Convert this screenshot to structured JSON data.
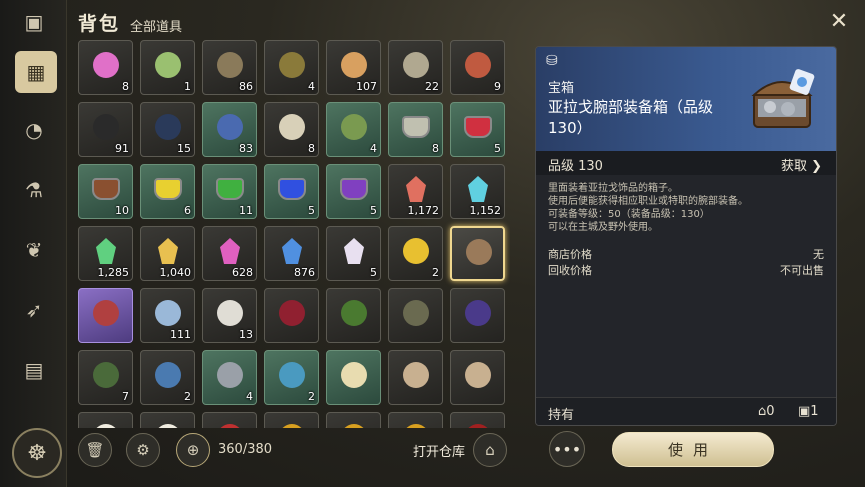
{
  "header": {
    "title": "背包",
    "filter": "全部道具"
  },
  "grid": {
    "rows": [
      [
        {
          "icon": "potion-pink",
          "qty": "8",
          "style": "dark"
        },
        {
          "icon": "potion-green-bottle",
          "qty": "1",
          "style": "dark"
        },
        {
          "icon": "worm",
          "qty": "86",
          "style": "dark"
        },
        {
          "icon": "beetle",
          "qty": "4",
          "style": "dark"
        },
        {
          "icon": "orange-orb",
          "qty": "107",
          "style": "dark"
        },
        {
          "icon": "stone-ball",
          "qty": "22",
          "style": "dark"
        },
        {
          "icon": "red-worm",
          "qty": "9",
          "style": "dark"
        }
      ],
      [
        {
          "icon": "coil-rope",
          "qty": "91",
          "style": "dark"
        },
        {
          "icon": "ink-quill",
          "qty": "15",
          "style": "dark"
        },
        {
          "icon": "blue-book",
          "qty": "83",
          "style": "green"
        },
        {
          "icon": "scroll",
          "qty": "8",
          "style": "dark"
        },
        {
          "icon": "green-scroll",
          "qty": "4",
          "style": "green"
        },
        {
          "icon": "gray-paint",
          "qty": "8",
          "style": "green"
        },
        {
          "icon": "red-paint",
          "qty": "5",
          "style": "green"
        }
      ],
      [
        {
          "icon": "brown-paint",
          "qty": "10",
          "style": "green"
        },
        {
          "icon": "yellow-paint",
          "qty": "6",
          "style": "green"
        },
        {
          "icon": "green-paint",
          "qty": "11",
          "style": "green"
        },
        {
          "icon": "blue-paint",
          "qty": "5",
          "style": "green"
        },
        {
          "icon": "purple-paint",
          "qty": "5",
          "style": "green"
        },
        {
          "icon": "red-crystal",
          "qty": "1,172",
          "style": "dark"
        },
        {
          "icon": "cyan-crystal",
          "qty": "1,152",
          "style": "dark"
        }
      ],
      [
        {
          "icon": "green-crystal",
          "qty": "1,285",
          "style": "dark"
        },
        {
          "icon": "gold-crystal",
          "qty": "1,040",
          "style": "dark"
        },
        {
          "icon": "pink-crystal",
          "qty": "628",
          "style": "dark"
        },
        {
          "icon": "blue-crystal",
          "qty": "876",
          "style": "dark"
        },
        {
          "icon": "prism",
          "qty": "5",
          "style": "dark"
        },
        {
          "icon": "gold-potion",
          "qty": "2",
          "style": "dark"
        },
        {
          "icon": "treasure-chest",
          "qty": "",
          "style": "selected"
        }
      ],
      [
        {
          "icon": "armor",
          "qty": "",
          "style": "purple"
        },
        {
          "icon": "blue-cloth",
          "qty": "111",
          "style": "dark"
        },
        {
          "icon": "white-cube",
          "qty": "13",
          "style": "dark"
        },
        {
          "icon": "red-dye",
          "qty": "",
          "style": "dark"
        },
        {
          "icon": "green-dye",
          "qty": "",
          "style": "dark"
        },
        {
          "icon": "egg-rune",
          "qty": "",
          "style": "dark"
        },
        {
          "icon": "purple-orb",
          "qty": "",
          "style": "dark"
        }
      ],
      [
        {
          "icon": "green-mask",
          "qty": "7",
          "style": "dark"
        },
        {
          "icon": "blue-rock",
          "qty": "2",
          "style": "dark"
        },
        {
          "icon": "silver-rock",
          "qty": "4",
          "style": "green"
        },
        {
          "icon": "cyan-rock",
          "qty": "2",
          "style": "green"
        },
        {
          "icon": "map",
          "qty": "",
          "style": "green"
        },
        {
          "icon": "tan-stone",
          "qty": "",
          "style": "dark"
        },
        {
          "icon": "tan-stone",
          "qty": "",
          "style": "dark"
        }
      ],
      [
        {
          "icon": "envelope",
          "qty": "",
          "style": "dark"
        },
        {
          "icon": "envelope",
          "qty": "",
          "style": "dark"
        },
        {
          "icon": "gift-bag",
          "qty": "",
          "style": "dark"
        },
        {
          "icon": "goblet",
          "qty": "",
          "style": "dark"
        },
        {
          "icon": "goblet",
          "qty": "",
          "style": "dark"
        },
        {
          "icon": "goblet",
          "qty": "",
          "style": "dark"
        },
        {
          "icon": "wine-bottle",
          "qty": "",
          "style": "dark"
        }
      ]
    ]
  },
  "bottombar": {
    "capacity": "360/380",
    "open_warehouse": "打开仓库"
  },
  "detail": {
    "type": "宝箱",
    "name": "亚拉戈腕部装备箱（品级130）",
    "grade": "品级 130",
    "obtain": "获取",
    "description": [
      "里面装着亚拉戈饰品的箱子。",
      "使用后便能获得相应职业或特职的腕部装备。",
      "可装备等级：50（装备品级：130）",
      "可以在主城及野外使用。"
    ],
    "shop_price_label": "商店价格",
    "shop_price_value": "无",
    "recycle_label": "回收价格",
    "recycle_value": "不可出售",
    "holding_label": "持有",
    "holding_warehouse": "0",
    "holding_bag": "1"
  },
  "buttons": {
    "use": "使用",
    "more": "•••"
  }
}
